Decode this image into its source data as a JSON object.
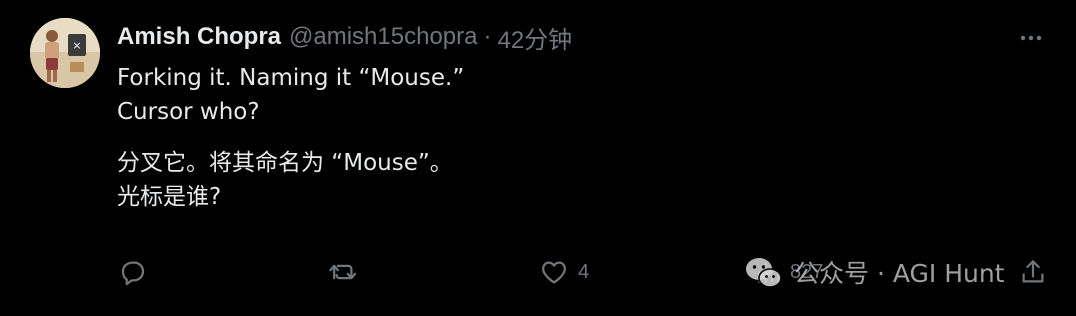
{
  "tweet": {
    "display_name": "Amish Chopra",
    "handle": "@amish15chopra",
    "separator": "·",
    "time": "42分钟",
    "text_lines": [
      "Forking it. Naming it “Mouse.”",
      "Cursor who?",
      "分叉它。将其命名为 “Mouse”。",
      "光标是谁?"
    ],
    "actions": {
      "reply_count": "",
      "retweet_count": "",
      "like_count": "4",
      "views_count": "827"
    }
  },
  "watermark": {
    "text": "公众号 · AGI Hunt"
  },
  "colors": {
    "background": "#000000",
    "primary_text": "#e7e9ea",
    "secondary_text": "#71767b"
  },
  "icons": [
    "more-icon",
    "reply-icon",
    "retweet-icon",
    "like-icon",
    "views-icon",
    "share-icon",
    "wechat-icon"
  ]
}
